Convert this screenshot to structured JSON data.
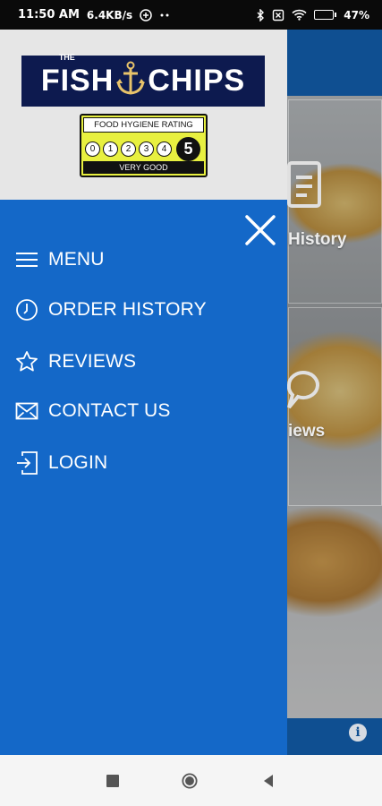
{
  "status_bar": {
    "time": "11:50 AM",
    "network_speed": "6.4KB/s",
    "battery": "47%",
    "battery_level": 0.47
  },
  "background_app": {
    "tile_history_label": "History",
    "tile_reviews_label": "iews"
  },
  "drawer": {
    "logo": {
      "the": "THE",
      "left": "FISH",
      "right": "CHIPS"
    },
    "hygiene_rating": {
      "title": "FOOD HYGIENE RATING",
      "scores": [
        "0",
        "1",
        "2",
        "3",
        "4"
      ],
      "rating": "5",
      "verdict": "VERY GOOD"
    },
    "menu_items": [
      {
        "label": "MENU",
        "icon": "hamburger-icon"
      },
      {
        "label": "ORDER HISTORY",
        "icon": "clock-icon"
      },
      {
        "label": "REVIEWS",
        "icon": "star-icon"
      },
      {
        "label": "CONTACT US",
        "icon": "envelope-icon"
      },
      {
        "label": "LOGIN",
        "icon": "login-icon"
      }
    ]
  },
  "colors": {
    "drawer_blue": "#1468c8",
    "header_grey": "#e6e6e6",
    "logo_navy": "#0d1a4f",
    "hygiene_yellow": "#e8f040"
  }
}
